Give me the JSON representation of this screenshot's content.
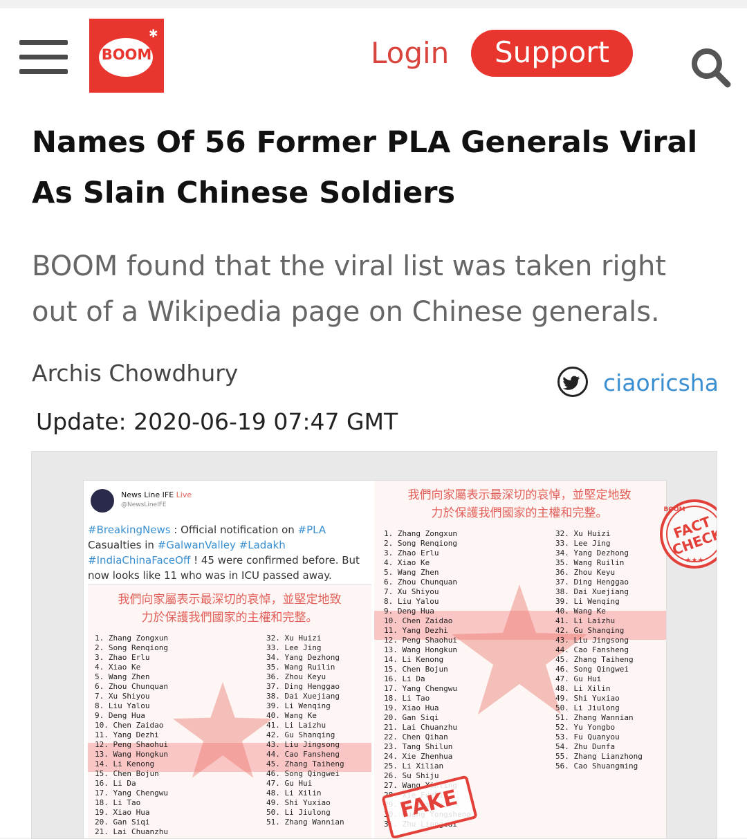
{
  "header": {
    "logo_text": "BOOM",
    "login_label": "Login",
    "support_label": "Support"
  },
  "article": {
    "title": "Names Of 56 Former PLA Generals Viral As Slain Chinese Soldiers",
    "subtitle": "BOOM found that the viral list was taken right out of a Wikipedia page on Chinese generals.",
    "author": "Archis Chowdhury",
    "twitter_handle": "ciaoricsha",
    "update": "Update: 2020-06-19 07:47 GMT"
  },
  "image": {
    "tweet_name": "News Line IFE",
    "tweet_live": "Live",
    "tweet_user": "@NewsLineIFE",
    "tweet_tag1": "#BreakingNews",
    "tweet_text1": " : Official notification on ",
    "tweet_tag2": "#PLA",
    "tweet_text2": " Casualties in ",
    "tweet_tag3": "#GalwanValley #Ladakh #IndiaChinaFaceOff",
    "tweet_text3": " ! 45 were confirmed before. But now looks like 11 who was in ICU passed away.",
    "chinese_line1": "我們向家屬表示最深切的哀悼，並堅定地致",
    "chinese_line2": "力於保護我們國家的主權和完整。",
    "names_col1": "1. Zhang Zongxun\n2. Song Renqiong\n3. Zhao Erlu\n4. Xiao Ke\n5. Wang Zhen\n6. Zhou Chunquan\n7. Xu Shiyou\n8. Liu Yalou\n9. Deng Hua\n10. Chen Zaidao\n11. Yang Dezhi\n12. Peng Shaohui\n13. Wang Hongkun\n14. Li Kenong\n15. Chen Bojun\n16. Li Da\n17. Yang Chengwu\n18. Li Tao\n19. Xiao Hua\n20. Gan Siqi\n21. Lai Chuanzhu\n22. Chen Qihan\n23. Tang Shilun\n24. Xie Zhenhua\n25. Li Xilian\n26. Su Shiju\n27. Wang Xinting\n28. Xie Fuzhi\n29. Ye Fei\n30. Huang Yongsheng\n31. Zhu Liangcai",
    "names_col2": "32. Xu Huizi\n33. Lee Jing\n34. Yang Dezhong\n35. Wang Ruilin\n36. Zhou Keyu\n37. Ding Henggao\n38. Dai Xuejiang\n39. Li Wenqing\n40. Wang Ke\n41. Li Laizhu\n42. Gu Shanqing\n43. Liu Jingsong\n44. Cao Fansheng\n45. Zhang Taiheng\n46. Song Qingwei\n47. Gu Hui\n48. Li Xilin\n49. Shi Yuxiao\n50. Li Jiulong\n51. Zhang Wannian\n52. Yu Yongbo\n53. Fu Quanyou\n54. Zhu Dunfa\n55. Zhang Lianzhong\n56. Cao Shuangming",
    "names_left_col1": "1. Zhang Zongxun\n2. Song Renqiong\n3. Zhao Erlu\n4. Xiao Ke\n5. Wang Zhen\n6. Zhou Chunquan\n7. Xu Shiyou\n8. Liu Yalou\n9. Deng Hua\n10. Chen Zaidao\n11. Yang Dezhi\n12. Peng Shaohui\n13. Wang Hongkun\n14. Li Kenong\n15. Chen Bojun\n16. Li Da\n17. Yang Chengwu\n18. Li Tao\n19. Xiao Hua\n20. Gan Siqi\n21. Lai Chuanzhu",
    "names_left_col2": "32. Xu Huizi\n33. Lee Jing\n34. Yang Dezhong\n35. Wang Ruilin\n36. Zhou Keyu\n37. Ding Henggao\n38. Dai Xuejiang\n39. Li Wenqing\n40. Wang Ke\n41. Li Laizhu\n42. Gu Shanqing\n43. Liu Jingsong\n44. Cao Fansheng\n45. Zhang Taiheng\n46. Song Qingwei\n47. Gu Hui\n48. Li Xilin\n49. Shi Yuxiao\n50. Li Jiulong\n51. Zhang Wannian",
    "fact_check_line1": "FACT",
    "fact_check_line2": "CHECK",
    "fact_check_brand": "BOOM",
    "fake_stamp": "FAKE"
  },
  "colors": {
    "brand_red": "#e8352e",
    "link_blue": "#3a8fd0"
  }
}
